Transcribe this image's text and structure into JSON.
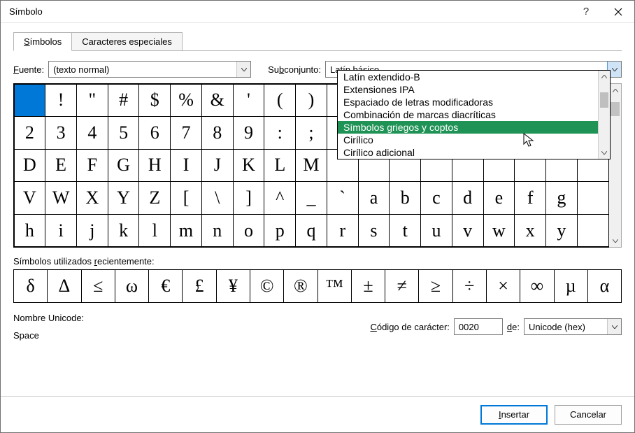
{
  "title": "Símbolo",
  "tabs": {
    "symbols": "Símbolos",
    "special": "Caracteres especiales"
  },
  "labels": {
    "font": "Fuente:",
    "subset": "Subconjunto:",
    "recent": "Símbolos utilizados recientemente:",
    "unicode_name": "Nombre Unicode:",
    "char_code": "Código de carácter:",
    "from": "de:"
  },
  "font_value": "(texto normal)",
  "subset_value": "Latín básico",
  "subset_options": [
    "Latín extendido-B",
    "Extensiones IPA",
    "Espaciado de letras modificadoras",
    "Combinación de marcas diacríticas",
    "Símbolos griegos y coptos",
    "Cirílico",
    "Cirílico adicional"
  ],
  "subset_highlight_index": 4,
  "grid_rows": [
    [
      "",
      "!",
      "\"",
      "#",
      "$",
      "%",
      "&",
      "'",
      "(",
      ")",
      "",
      "",
      "",
      "",
      "",
      "",
      "",
      "",
      ""
    ],
    [
      "2",
      "3",
      "4",
      "5",
      "6",
      "7",
      "8",
      "9",
      ":",
      ";",
      "",
      "",
      "",
      "",
      "",
      "",
      "",
      "",
      ""
    ],
    [
      "D",
      "E",
      "F",
      "G",
      "H",
      "I",
      "J",
      "K",
      "L",
      "M",
      "",
      "",
      "",
      "",
      "",
      "",
      "",
      "",
      ""
    ],
    [
      "V",
      "W",
      "X",
      "Y",
      "Z",
      "[",
      "\\",
      "]",
      "^",
      "_",
      "`",
      "a",
      "b",
      "c",
      "d",
      "e",
      "f",
      "g",
      ""
    ],
    [
      "h",
      "i",
      "j",
      "k",
      "l",
      "m",
      "n",
      "o",
      "p",
      "q",
      "r",
      "s",
      "t",
      "u",
      "v",
      "w",
      "x",
      "y",
      ""
    ]
  ],
  "recent": [
    "δ",
    "Δ",
    "≤",
    "ω",
    "€",
    "£",
    "¥",
    "©",
    "®",
    "™",
    "±",
    "≠",
    "≥",
    "÷",
    "×",
    "∞",
    "µ",
    "α"
  ],
  "unicode_name_value": "Space",
  "char_code_value": "0020",
  "encoding_value": "Unicode (hex)",
  "buttons": {
    "insert": "Insertar",
    "cancel": "Cancelar"
  }
}
